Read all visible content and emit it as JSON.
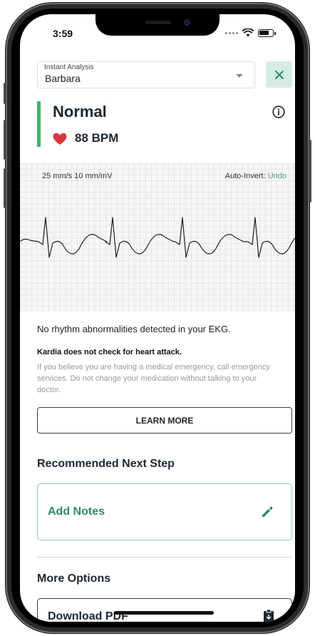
{
  "status_bar": {
    "time": "3:59"
  },
  "header": {
    "selector_label": "Instant Analysis",
    "selector_value": "Barbara"
  },
  "result": {
    "title": "Normal",
    "heart_rate": "88 BPM",
    "status_color": "#3bba60"
  },
  "ekg": {
    "scale": "25 mm/s 10 mm/mV",
    "auto_invert_label": "Auto-Invert:",
    "undo_label": "Undo"
  },
  "message": {
    "main": "No rhythm abnormalities detected in your EKG.",
    "bold": "Kardia does not check for heart attack.",
    "detail": "If you believe you are having a medical emergency, call emergency services. Do not change your medication without talking to your doctor."
  },
  "buttons": {
    "learn_more": "LEARN MORE"
  },
  "next_step": {
    "heading": "Recommended Next Step",
    "add_notes": "Add Notes"
  },
  "more_options": {
    "heading": "More Options",
    "download_pdf": "Download PDF"
  },
  "colors": {
    "accent": "#2e8a70",
    "undo": "#3ea58b",
    "heart": "#d4383f"
  },
  "icons": [
    "close-icon",
    "info-icon",
    "heart-icon",
    "pencil-icon",
    "clipboard-icon",
    "wifi-icon",
    "battery-icon"
  ]
}
